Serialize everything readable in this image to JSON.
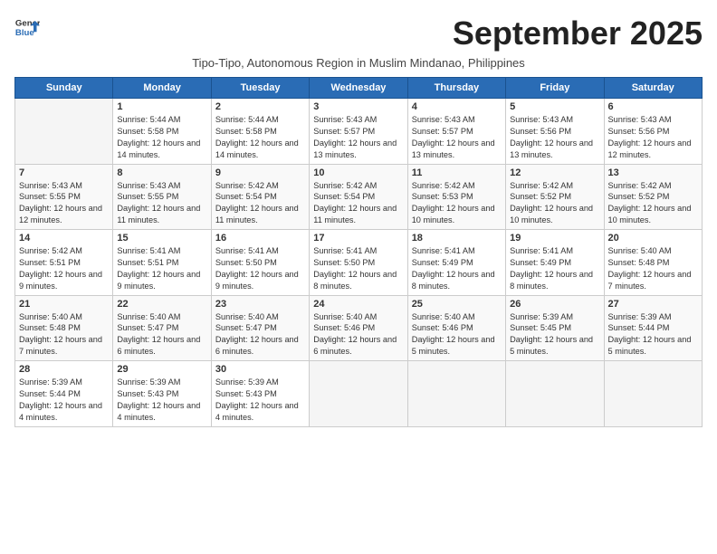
{
  "header": {
    "logo_line1": "General",
    "logo_line2": "Blue",
    "month_title": "September 2025",
    "subtitle": "Tipo-Tipo, Autonomous Region in Muslim Mindanao, Philippines"
  },
  "weekdays": [
    "Sunday",
    "Monday",
    "Tuesday",
    "Wednesday",
    "Thursday",
    "Friday",
    "Saturday"
  ],
  "weeks": [
    [
      {
        "day": "",
        "info": ""
      },
      {
        "day": "1",
        "info": "Sunrise: 5:44 AM\nSunset: 5:58 PM\nDaylight: 12 hours\nand 14 minutes."
      },
      {
        "day": "2",
        "info": "Sunrise: 5:44 AM\nSunset: 5:58 PM\nDaylight: 12 hours\nand 14 minutes."
      },
      {
        "day": "3",
        "info": "Sunrise: 5:43 AM\nSunset: 5:57 PM\nDaylight: 12 hours\nand 13 minutes."
      },
      {
        "day": "4",
        "info": "Sunrise: 5:43 AM\nSunset: 5:57 PM\nDaylight: 12 hours\nand 13 minutes."
      },
      {
        "day": "5",
        "info": "Sunrise: 5:43 AM\nSunset: 5:56 PM\nDaylight: 12 hours\nand 13 minutes."
      },
      {
        "day": "6",
        "info": "Sunrise: 5:43 AM\nSunset: 5:56 PM\nDaylight: 12 hours\nand 12 minutes."
      }
    ],
    [
      {
        "day": "7",
        "info": "Sunrise: 5:43 AM\nSunset: 5:55 PM\nDaylight: 12 hours\nand 12 minutes."
      },
      {
        "day": "8",
        "info": "Sunrise: 5:43 AM\nSunset: 5:55 PM\nDaylight: 12 hours\nand 11 minutes."
      },
      {
        "day": "9",
        "info": "Sunrise: 5:42 AM\nSunset: 5:54 PM\nDaylight: 12 hours\nand 11 minutes."
      },
      {
        "day": "10",
        "info": "Sunrise: 5:42 AM\nSunset: 5:54 PM\nDaylight: 12 hours\nand 11 minutes."
      },
      {
        "day": "11",
        "info": "Sunrise: 5:42 AM\nSunset: 5:53 PM\nDaylight: 12 hours\nand 10 minutes."
      },
      {
        "day": "12",
        "info": "Sunrise: 5:42 AM\nSunset: 5:52 PM\nDaylight: 12 hours\nand 10 minutes."
      },
      {
        "day": "13",
        "info": "Sunrise: 5:42 AM\nSunset: 5:52 PM\nDaylight: 12 hours\nand 10 minutes."
      }
    ],
    [
      {
        "day": "14",
        "info": "Sunrise: 5:42 AM\nSunset: 5:51 PM\nDaylight: 12 hours\nand 9 minutes."
      },
      {
        "day": "15",
        "info": "Sunrise: 5:41 AM\nSunset: 5:51 PM\nDaylight: 12 hours\nand 9 minutes."
      },
      {
        "day": "16",
        "info": "Sunrise: 5:41 AM\nSunset: 5:50 PM\nDaylight: 12 hours\nand 9 minutes."
      },
      {
        "day": "17",
        "info": "Sunrise: 5:41 AM\nSunset: 5:50 PM\nDaylight: 12 hours\nand 8 minutes."
      },
      {
        "day": "18",
        "info": "Sunrise: 5:41 AM\nSunset: 5:49 PM\nDaylight: 12 hours\nand 8 minutes."
      },
      {
        "day": "19",
        "info": "Sunrise: 5:41 AM\nSunset: 5:49 PM\nDaylight: 12 hours\nand 8 minutes."
      },
      {
        "day": "20",
        "info": "Sunrise: 5:40 AM\nSunset: 5:48 PM\nDaylight: 12 hours\nand 7 minutes."
      }
    ],
    [
      {
        "day": "21",
        "info": "Sunrise: 5:40 AM\nSunset: 5:48 PM\nDaylight: 12 hours\nand 7 minutes."
      },
      {
        "day": "22",
        "info": "Sunrise: 5:40 AM\nSunset: 5:47 PM\nDaylight: 12 hours\nand 6 minutes."
      },
      {
        "day": "23",
        "info": "Sunrise: 5:40 AM\nSunset: 5:47 PM\nDaylight: 12 hours\nand 6 minutes."
      },
      {
        "day": "24",
        "info": "Sunrise: 5:40 AM\nSunset: 5:46 PM\nDaylight: 12 hours\nand 6 minutes."
      },
      {
        "day": "25",
        "info": "Sunrise: 5:40 AM\nSunset: 5:46 PM\nDaylight: 12 hours\nand 5 minutes."
      },
      {
        "day": "26",
        "info": "Sunrise: 5:39 AM\nSunset: 5:45 PM\nDaylight: 12 hours\nand 5 minutes."
      },
      {
        "day": "27",
        "info": "Sunrise: 5:39 AM\nSunset: 5:44 PM\nDaylight: 12 hours\nand 5 minutes."
      }
    ],
    [
      {
        "day": "28",
        "info": "Sunrise: 5:39 AM\nSunset: 5:44 PM\nDaylight: 12 hours\nand 4 minutes."
      },
      {
        "day": "29",
        "info": "Sunrise: 5:39 AM\nSunset: 5:43 PM\nDaylight: 12 hours\nand 4 minutes."
      },
      {
        "day": "30",
        "info": "Sunrise: 5:39 AM\nSunset: 5:43 PM\nDaylight: 12 hours\nand 4 minutes."
      },
      {
        "day": "",
        "info": ""
      },
      {
        "day": "",
        "info": ""
      },
      {
        "day": "",
        "info": ""
      },
      {
        "day": "",
        "info": ""
      }
    ]
  ]
}
